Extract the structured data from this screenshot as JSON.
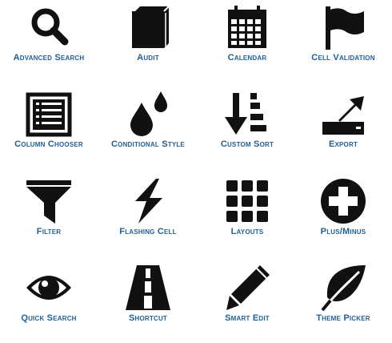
{
  "icons": [
    {
      "label": "Advanced Search",
      "icon": "magnifier-icon"
    },
    {
      "label": "Audit",
      "icon": "book-icon"
    },
    {
      "label": "Calendar",
      "icon": "calendar-icon"
    },
    {
      "label": "Cell Validation",
      "icon": "flag-icon"
    },
    {
      "label": "Column Chooser",
      "icon": "list-window-icon"
    },
    {
      "label": "Conditional Style",
      "icon": "droplets-icon"
    },
    {
      "label": "Custom Sort",
      "icon": "sort-descending-icon"
    },
    {
      "label": "Export",
      "icon": "export-arrow-icon"
    },
    {
      "label": "Filter",
      "icon": "funnel-icon"
    },
    {
      "label": "Flashing Cell",
      "icon": "lightning-icon"
    },
    {
      "label": "Layouts",
      "icon": "grid-icon"
    },
    {
      "label": "Plus/Minus",
      "icon": "plus-circle-icon"
    },
    {
      "label": "Quick Search",
      "icon": "eye-icon"
    },
    {
      "label": "Shortcut",
      "icon": "road-icon"
    },
    {
      "label": "Smart Edit",
      "icon": "pencil-icon"
    },
    {
      "label": "Theme Picker",
      "icon": "leaf-icon"
    }
  ],
  "colors": {
    "label": "#1f5f98",
    "icon": "#111111",
    "background": "#ffffff"
  }
}
